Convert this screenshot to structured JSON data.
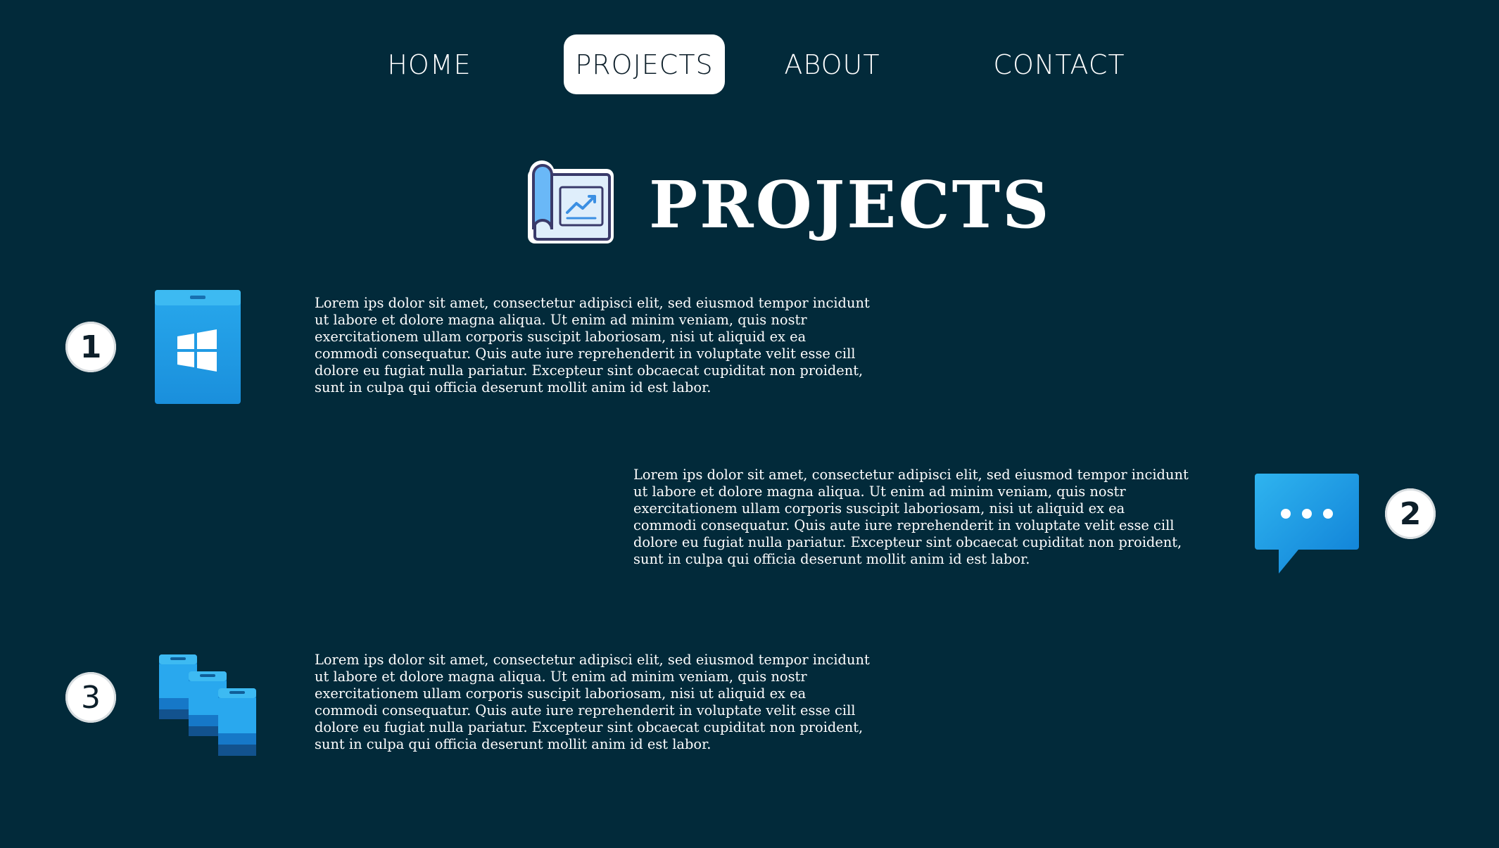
{
  "nav": {
    "items": [
      {
        "label": "HOME",
        "active": false
      },
      {
        "label": "PROJECTS",
        "active": true
      },
      {
        "label": "ABOUT",
        "active": false
      },
      {
        "label": "CONTACT",
        "active": false
      }
    ]
  },
  "header": {
    "title": "PROJECTS",
    "icon": "blueprint-chart-icon"
  },
  "projects": [
    {
      "number": "1",
      "icon": "windows-phone-icon",
      "description": "Lorem ips dolor sit amet, consectetur adipisci elit, sed eiusmod tempor incidunt ut labore et dolore magna aliqua. Ut enim ad minim veniam, quis nostr exercitationem ullam corporis suscipit laboriosam, nisi ut aliquid ex ea commodi consequatur. Quis aute iure reprehenderit in voluptate velit esse cill dolore eu fugiat nulla pariatur. Excepteur sint obcaecat cupiditat non proident, sunt in culpa qui officia deserunt mollit anim id est labor."
    },
    {
      "number": "2",
      "icon": "chat-bubble-icon",
      "description": "Lorem ips dolor sit amet, consectetur adipisci elit, sed eiusmod tempor incidunt ut labore et dolore magna aliqua. Ut enim ad minim veniam, quis nostr exercitationem ullam corporis suscipit laboriosam, nisi ut aliquid ex ea commodi consequatur. Quis aute iure reprehenderit in voluptate velit esse cill dolore eu fugiat nulla pariatur. Excepteur sint obcaecat cupiditat non proident, sunt in culpa qui officia deserunt mollit anim id est labor."
    },
    {
      "number": "3",
      "icon": "multiple-devices-icon",
      "description": "Lorem ips dolor sit amet, consectetur adipisci elit, sed eiusmod tempor incidunt ut labore et dolore magna aliqua. Ut enim ad minim veniam, quis nostr exercitationem ullam corporis suscipit laboriosam, nisi ut aliquid ex ea commodi consequatur. Quis aute iure reprehenderit in voluptate velit esse cill dolore eu fugiat nulla pariatur. Excepteur sint obcaecat cupiditat non proident, sunt in culpa qui officia deserunt mollit anim id est labor."
    }
  ],
  "colors": {
    "background": "#022a3a",
    "accent_blue": "#1e9be3",
    "text": "#ffffff"
  }
}
